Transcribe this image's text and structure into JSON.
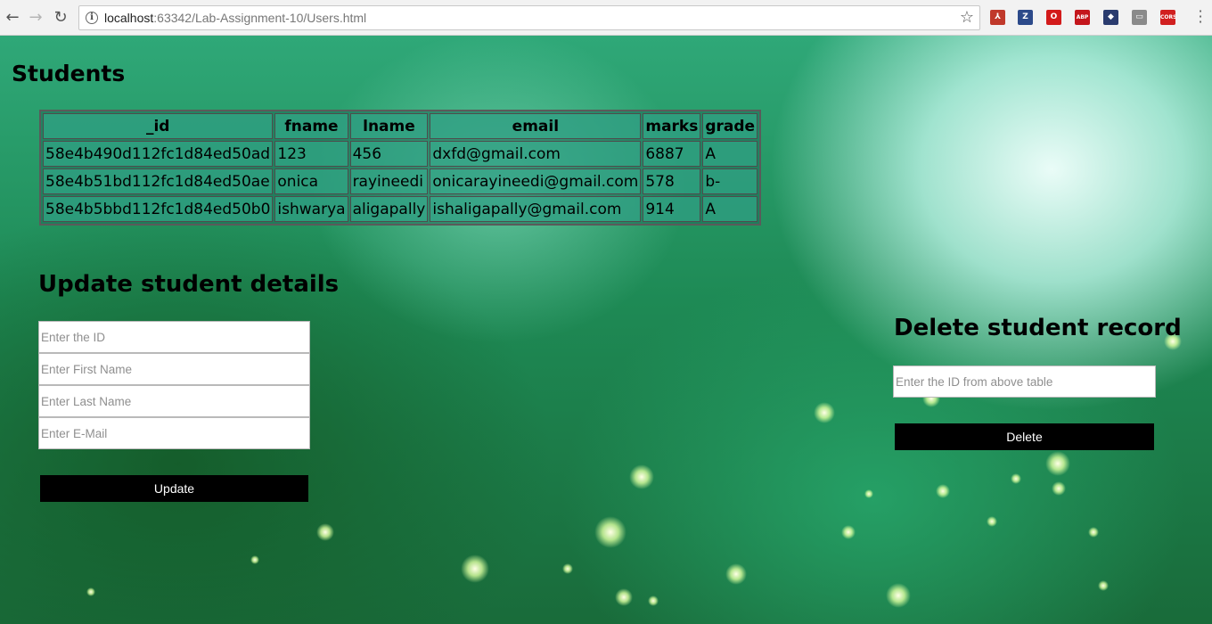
{
  "browser": {
    "url_host": "localhost",
    "url_path": ":63342/Lab-Assignment-10/Users.html",
    "extensions": [
      {
        "name": "acrobat-icon",
        "glyph": "⅄",
        "color": "#c0392b"
      },
      {
        "name": "zotero-icon",
        "glyph": "Z",
        "color": "#2c4a8a"
      },
      {
        "name": "opera-icon",
        "glyph": "O",
        "color": "#d31b1b"
      },
      {
        "name": "adblock-plus-icon",
        "glyph": "ABP",
        "color": "#c4161c"
      },
      {
        "name": "extension-icon",
        "glyph": "◆",
        "color": "#2a3b6e"
      },
      {
        "name": "extension-gray-icon",
        "glyph": "▭",
        "color": "#8a8a8a"
      },
      {
        "name": "cors-icon",
        "glyph": "CORS",
        "color": "#d12020"
      }
    ]
  },
  "students": {
    "title": "Students",
    "columns": [
      "_id",
      "fname",
      "lname",
      "email",
      "marks",
      "grade"
    ],
    "rows": [
      [
        "58e4b490d112fc1d84ed50ad",
        "123",
        "456",
        "dxfd@gmail.com",
        "6887",
        "A"
      ],
      [
        "58e4b51bd112fc1d84ed50ae",
        "onica",
        "rayineedi",
        "onicarayineedi@gmail.com",
        "578",
        "b-"
      ],
      [
        "58e4b5bbd112fc1d84ed50b0",
        "ishwarya",
        "aligapally",
        "ishaligapally@gmail.com",
        "914",
        "A"
      ]
    ]
  },
  "update": {
    "title": "Update student details",
    "id_placeholder": "Enter the ID",
    "fname_placeholder": "Enter First Name",
    "lname_placeholder": "Enter Last Name",
    "email_placeholder": "Enter E-Mail",
    "button_label": "Update"
  },
  "delete": {
    "title": "Delete student record",
    "id_placeholder": "Enter the ID from above table",
    "button_label": "Delete"
  }
}
